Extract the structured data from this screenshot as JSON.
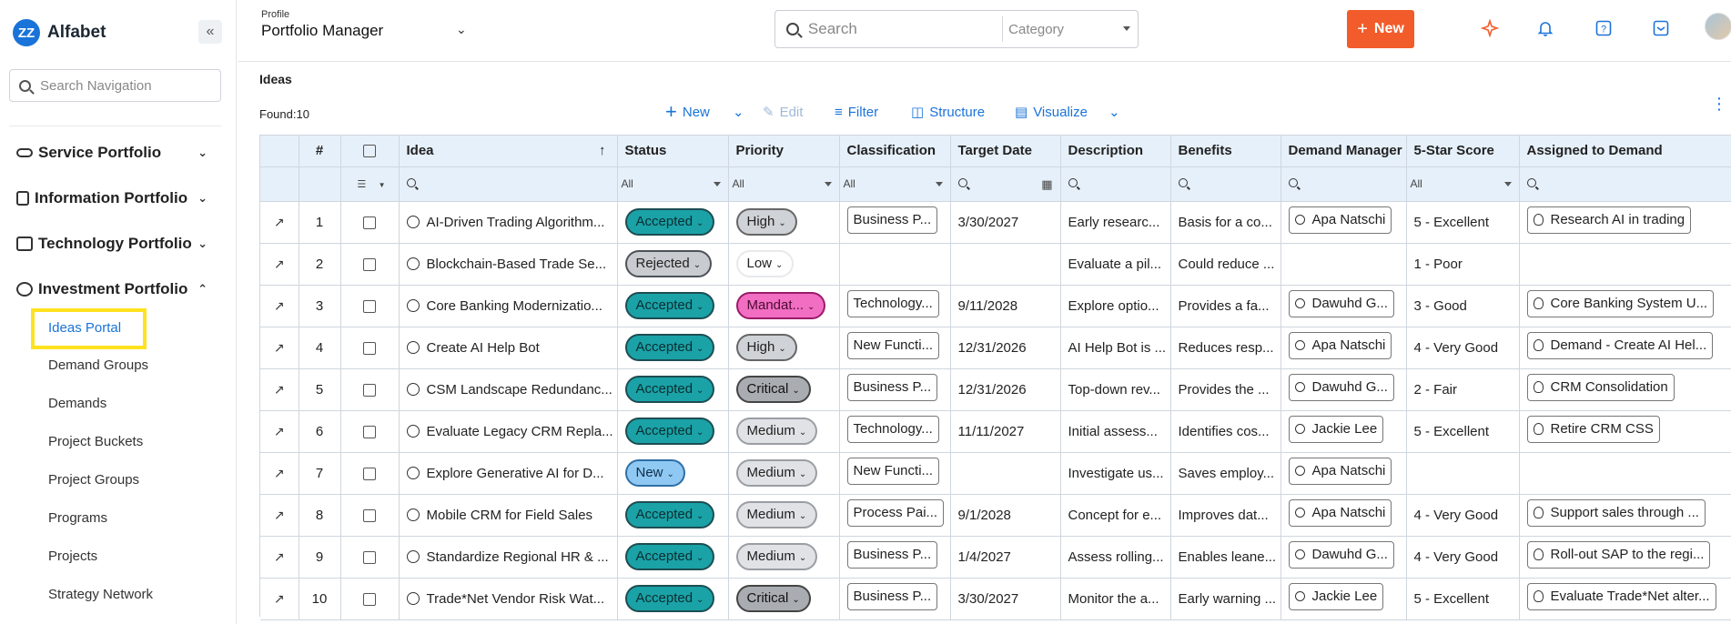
{
  "app": {
    "logo_mark": "ZZ",
    "logo_text": "Alfabet",
    "collapse_icon": "double-chevron-left-icon"
  },
  "sidebar": {
    "search_placeholder": "Search Navigation",
    "groups": [
      {
        "label": "Service Portfolio",
        "icon": "service-icon",
        "expanded": false
      },
      {
        "label": "Information Portfolio",
        "icon": "information-icon",
        "expanded": false
      },
      {
        "label": "Technology Portfolio",
        "icon": "technology-icon",
        "expanded": false
      },
      {
        "label": "Investment Portfolio",
        "icon": "investment-icon",
        "expanded": true
      }
    ],
    "items": [
      {
        "label": "Ideas Portal",
        "active": true
      },
      {
        "label": "Demand Groups"
      },
      {
        "label": "Demands"
      },
      {
        "label": "Project Buckets"
      },
      {
        "label": "Project Groups"
      },
      {
        "label": "Programs"
      },
      {
        "label": "Projects"
      },
      {
        "label": "Strategy Network"
      }
    ],
    "highlight_color": "#ffe21f"
  },
  "header": {
    "profile_label": "Profile",
    "profile_name": "Portfolio Manager",
    "search_placeholder": "Search",
    "category_placeholder": "Category",
    "new_button": "New",
    "new_button_color": "#f25c2a",
    "icons": [
      "ai-spark-icon",
      "bell-icon",
      "help-icon",
      "inbox-icon",
      "user-avatar"
    ]
  },
  "page": {
    "title": "Ideas",
    "found_label": "Found:",
    "found_count": "10"
  },
  "toolbar": {
    "new": "New",
    "edit": "Edit",
    "filter": "Filter",
    "structure": "Structure",
    "visualize": "Visualize"
  },
  "table": {
    "columns": [
      "#",
      "",
      "Idea",
      "Status",
      "Priority",
      "Classification",
      "Target Date",
      "Description",
      "Benefits",
      "Demand Manager",
      "5-Star Score",
      "Assigned to Demand"
    ],
    "filters": {
      "status": "All",
      "priority": "All",
      "classification": "All",
      "score": "All"
    },
    "rows": [
      {
        "num": "1",
        "idea": "AI-Driven Trading Algorithm...",
        "status": "Accepted",
        "priority": "High",
        "classification": "Business P...",
        "target_date": "3/30/2027",
        "description": "Early researc...",
        "benefits": "Basis for a co...",
        "manager": "Apa Natschi",
        "score": "5 - Excellent",
        "demand": "Research AI in trading"
      },
      {
        "num": "2",
        "idea": "Blockchain-Based Trade Se...",
        "status": "Rejected",
        "priority": "Low",
        "classification": "",
        "target_date": "",
        "description": "Evaluate a pil...",
        "benefits": "Could reduce ...",
        "manager": "",
        "score": "1 - Poor",
        "demand": ""
      },
      {
        "num": "3",
        "idea": "Core Banking Modernizatio...",
        "status": "Accepted",
        "priority": "Mandat...",
        "classification": "Technology...",
        "target_date": "9/11/2028",
        "description": "Explore optio...",
        "benefits": "Provides a fa...",
        "manager": "Dawuhd G...",
        "score": "3 - Good",
        "demand": "Core Banking System U..."
      },
      {
        "num": "4",
        "idea": "Create AI Help Bot",
        "status": "Accepted",
        "priority": "High",
        "classification": "New Functi...",
        "target_date": "12/31/2026",
        "description": "AI Help Bot is ...",
        "benefits": "Reduces resp...",
        "manager": "Apa Natschi",
        "score": "4 - Very Good",
        "demand": "Demand - Create AI Hel..."
      },
      {
        "num": "5",
        "idea": "CSM Landscape Redundanc...",
        "status": "Accepted",
        "priority": "Critical",
        "classification": "Business P...",
        "target_date": "12/31/2026",
        "description": "Top-down rev...",
        "benefits": "Provides the ...",
        "manager": "Dawuhd G...",
        "score": "2 - Fair",
        "demand": "CRM Consolidation"
      },
      {
        "num": "6",
        "idea": "Evaluate Legacy CRM Repla...",
        "status": "Accepted",
        "priority": "Medium",
        "classification": "Technology...",
        "target_date": "11/11/2027",
        "description": "Initial assess...",
        "benefits": "Identifies cos...",
        "manager": "Jackie Lee",
        "score": "5 - Excellent",
        "demand": "Retire CRM CSS"
      },
      {
        "num": "7",
        "idea": "Explore Generative AI for D...",
        "status": "New",
        "priority": "Medium",
        "classification": "New Functi...",
        "target_date": "",
        "description": "Investigate us...",
        "benefits": "Saves employ...",
        "manager": "Apa Natschi",
        "score": "",
        "demand": ""
      },
      {
        "num": "8",
        "idea": "Mobile CRM for Field Sales",
        "status": "Accepted",
        "priority": "Medium",
        "classification": "Process Pai...",
        "target_date": "9/1/2028",
        "description": "Concept for e...",
        "benefits": "Improves dat...",
        "manager": "Apa Natschi",
        "score": "4 - Very Good",
        "demand": "Support sales through ..."
      },
      {
        "num": "9",
        "idea": "Standardize Regional HR & ...",
        "status": "Accepted",
        "priority": "Medium",
        "classification": "Business P...",
        "target_date": "1/4/2027",
        "description": "Assess rolling...",
        "benefits": "Enables leane...",
        "manager": "Dawuhd G...",
        "score": "4 - Very Good",
        "demand": "Roll-out SAP to the regi..."
      },
      {
        "num": "10",
        "idea": "Trade*Net Vendor Risk Wat...",
        "status": "Accepted",
        "priority": "Critical",
        "classification": "Business P...",
        "target_date": "3/30/2027",
        "description": "Monitor the a...",
        "benefits": "Early warning ...",
        "manager": "Jackie Lee",
        "score": "5 - Excellent",
        "demand": "Evaluate Trade*Net alter..."
      }
    ]
  }
}
